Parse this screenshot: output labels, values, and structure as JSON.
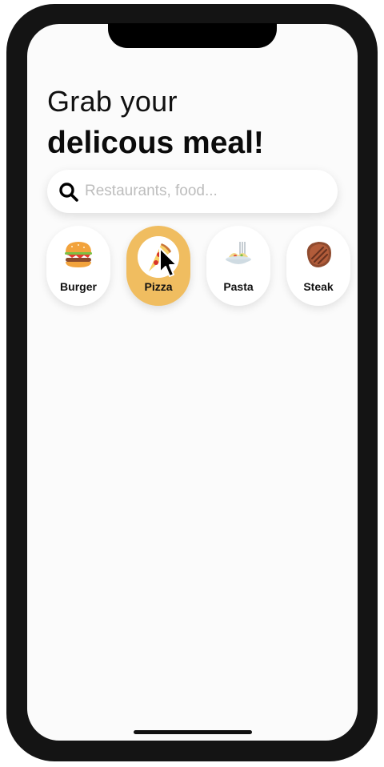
{
  "header": {
    "line1": "Grab your",
    "line2": "delicous meal!"
  },
  "search": {
    "placeholder": "Restaurants, food...",
    "icon": "search-icon"
  },
  "categories": [
    {
      "label": "Burger",
      "icon": "burger-icon",
      "active": false
    },
    {
      "label": "Pizza",
      "icon": "pizza-icon",
      "active": true
    },
    {
      "label": "Pasta",
      "icon": "pasta-icon",
      "active": false
    },
    {
      "label": "Steak",
      "icon": "steak-icon",
      "active": false
    }
  ],
  "colors": {
    "accent": "#f0bd60",
    "frame": "#141414",
    "background": "#fbfbfb"
  }
}
